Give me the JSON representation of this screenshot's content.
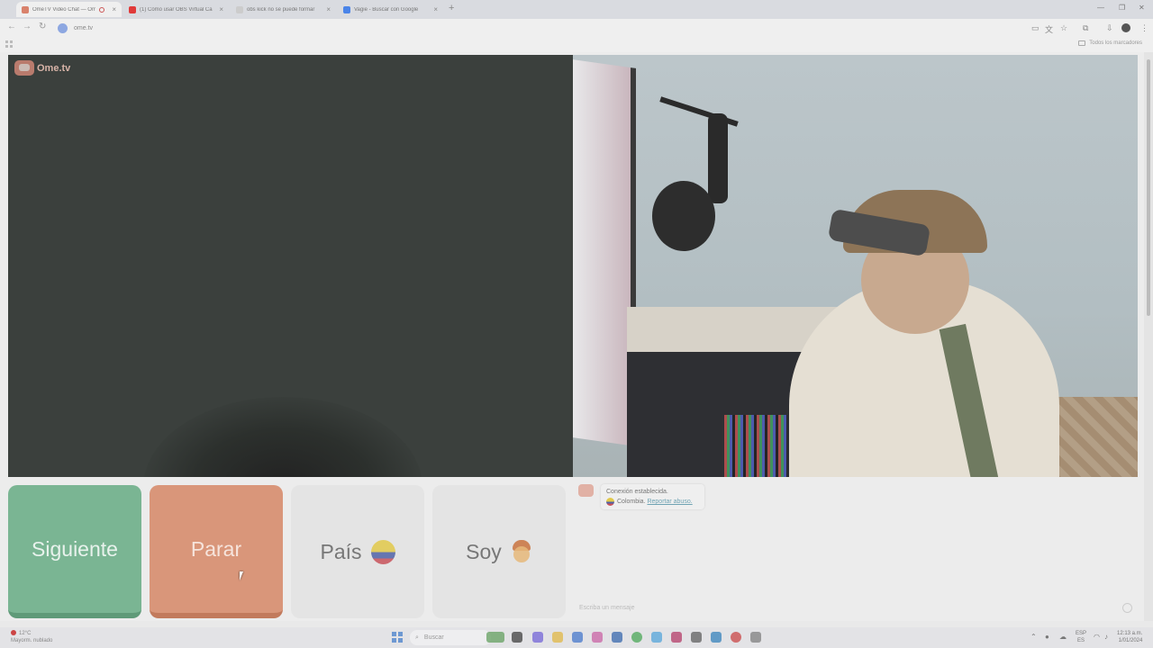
{
  "browser": {
    "tabs": [
      {
        "title": "OmeTV Video Chat — Ome",
        "active": true,
        "favicon_color": "#d9826c",
        "recording": true
      },
      {
        "title": "(1) Cómo usar OBS Virtual Ca",
        "active": false,
        "favicon_color": "#e03a3a",
        "recording": false
      },
      {
        "title": "obs kick no se puede formar",
        "active": false,
        "favicon_color": "#cccccc",
        "recording": false
      },
      {
        "title": "Vagie - Buscar con Google",
        "active": false,
        "favicon_color": "#4a84e8",
        "recording": false
      }
    ],
    "url": "ome.tv",
    "bookmarks_label": "Todos los marcadores"
  },
  "page": {
    "logo_text": "Ome.tv",
    "buttons": {
      "next": "Siguiente",
      "stop": "Parar",
      "country": "País",
      "me": "Soy"
    },
    "chat": {
      "status": "Conexión establecida.",
      "country": "Colombia.",
      "report": "Reportar abuso.",
      "placeholder": "Escriba un mensaje"
    }
  },
  "taskbar": {
    "weather_temp": "12°C",
    "weather_desc": "Mayorm. nublado",
    "search_placeholder": "Buscar",
    "lang_top": "ESP",
    "lang_bottom": "ES",
    "time": "12:13 a.m.",
    "date": "1/01/2024"
  },
  "colors": {
    "next_button": "#7ab593",
    "stop_button": "#d9967a",
    "neutral_button": "#e4e4e4"
  }
}
